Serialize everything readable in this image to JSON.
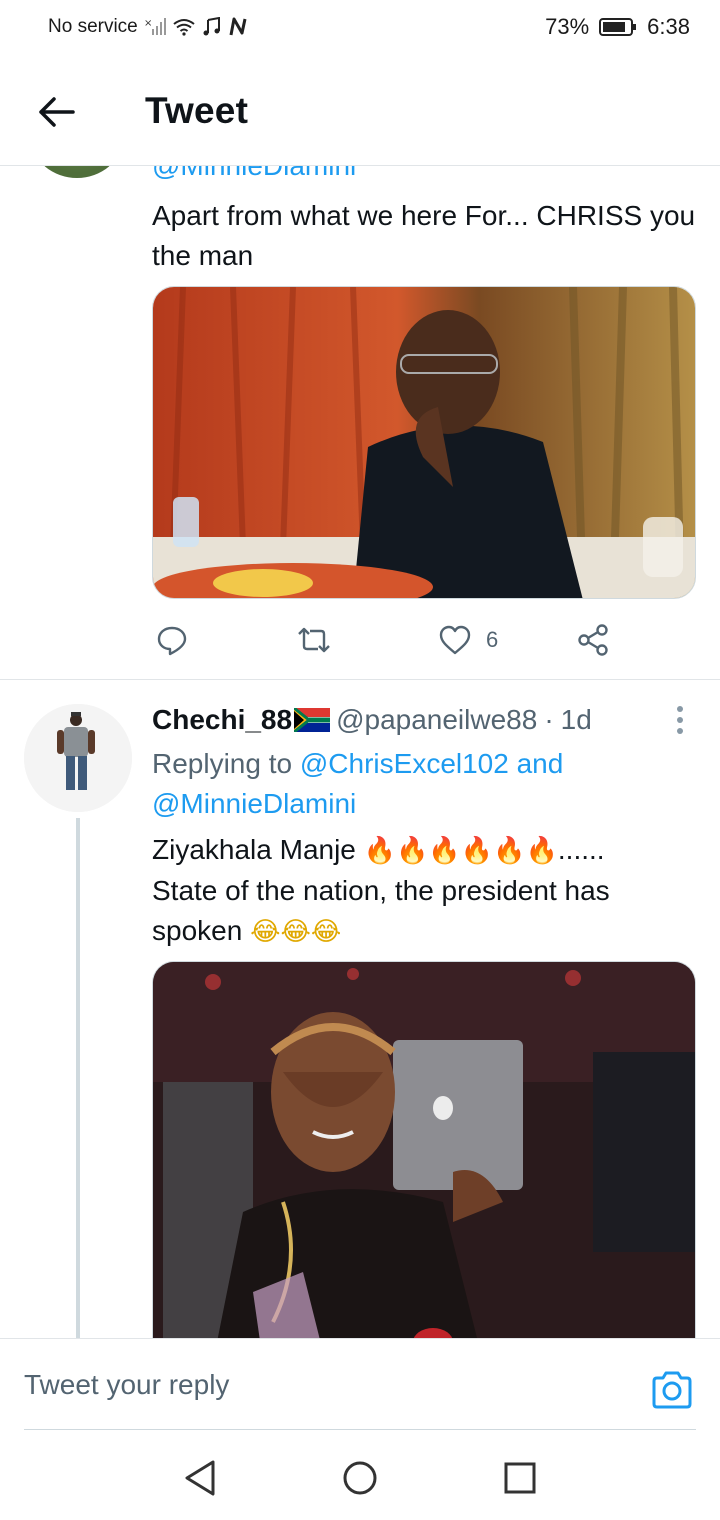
{
  "status_bar": {
    "carrier": "No service",
    "battery": "73%",
    "time": "6:38"
  },
  "header": {
    "title": "Tweet"
  },
  "tweet_above": {
    "handle": "@MinnieDlamini",
    "text": "Apart from what we here For... CHRISS you the man",
    "likes": "6"
  },
  "tweet_reply": {
    "display_name": "Chechi_88",
    "handle": "@papaneilwe88",
    "separator": "·",
    "age": "1d",
    "replying_prefix": "Replying to",
    "replying_to_1": "@ChrisExcel102",
    "replying_and": "and",
    "replying_to_2": "@MinnieDlamini",
    "text_line1": "Ziyakhala Manje",
    "text_dots": "......",
    "text_line2": "State of the nation, the president has",
    "text_line3": "spoken"
  },
  "composer": {
    "placeholder": "Tweet your reply"
  },
  "colors": {
    "accent": "#1d9bf0",
    "muted": "#536471",
    "border": "#e1e5e8"
  },
  "icons": [
    "back-arrow-icon",
    "reply-icon",
    "retweet-icon",
    "like-icon",
    "share-icon",
    "more-icon",
    "camera-icon",
    "nav-back-icon",
    "nav-home-icon",
    "nav-recents-icon"
  ]
}
